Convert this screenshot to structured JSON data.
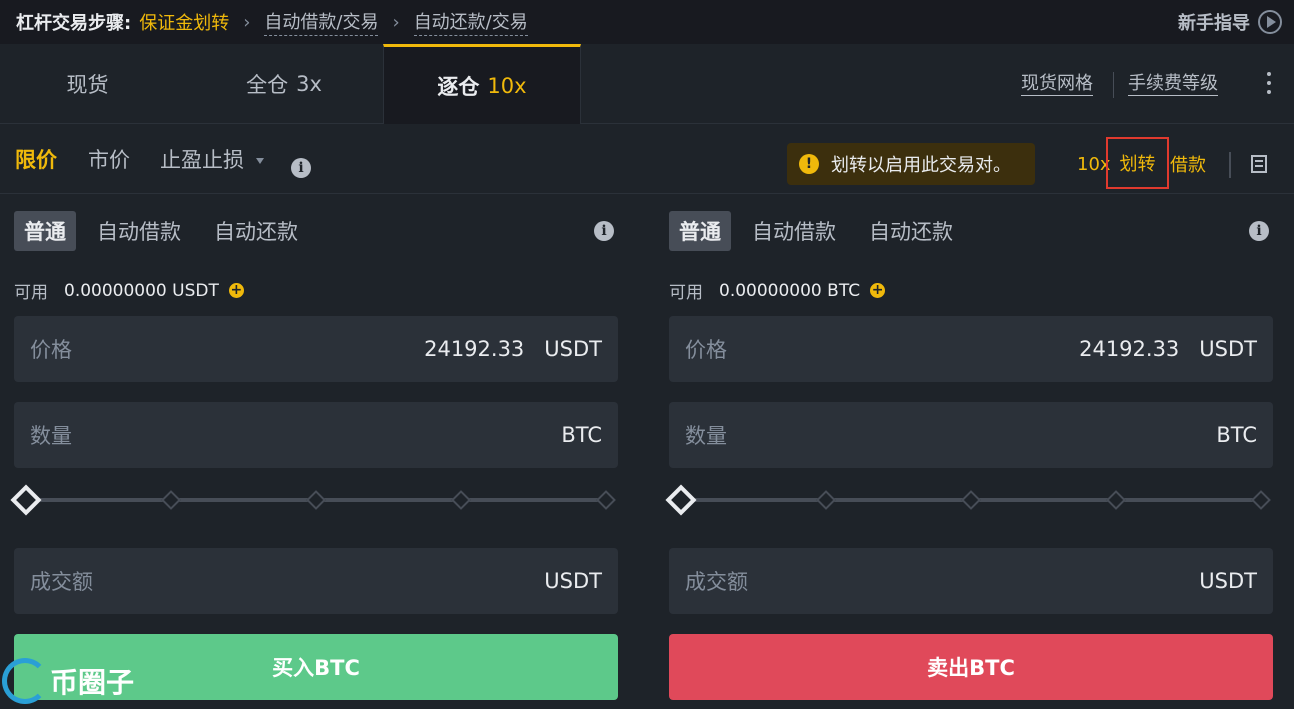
{
  "breadcrumb": {
    "title": "杠杆交易步骤:",
    "step1": "保证金划转",
    "step2": "自动借款/交易",
    "step3": "自动还款/交易",
    "guide": "新手指导"
  },
  "mode_tabs": [
    {
      "label": "现货",
      "leverage": ""
    },
    {
      "label": "全仓",
      "leverage": "3x"
    },
    {
      "label": "逐仓",
      "leverage": "10x"
    }
  ],
  "top_links": {
    "grid": "现货网格",
    "fee": "手续费等级"
  },
  "order_types": {
    "limit": "限价",
    "market": "市价",
    "stop": "止盈止损"
  },
  "banner": {
    "text": "划转以启用此交易对。"
  },
  "actions": {
    "leverage": "10x",
    "transfer": "划转",
    "borrow": "借款"
  },
  "buy_panel": {
    "subtabs": [
      "普通",
      "自动借款",
      "自动还款"
    ],
    "available_label": "可用",
    "available_value": "0.00000000 USDT",
    "price": {
      "label": "价格",
      "value": "24192.33",
      "unit": "USDT"
    },
    "amount": {
      "label": "数量",
      "value": "",
      "unit": "BTC"
    },
    "slider_value": 0,
    "total": {
      "label": "成交额",
      "unit": "USDT"
    },
    "button": "买入BTC"
  },
  "sell_panel": {
    "subtabs": [
      "普通",
      "自动借款",
      "自动还款"
    ],
    "available_label": "可用",
    "available_value": "0.00000000 BTC",
    "price": {
      "label": "价格",
      "value": "24192.33",
      "unit": "USDT"
    },
    "amount": {
      "label": "数量",
      "value": "",
      "unit": "BTC"
    },
    "slider_value": 0,
    "total": {
      "label": "成交额",
      "unit": "USDT"
    },
    "button": "卖出BTC"
  },
  "watermark": {
    "text": "币圈子"
  },
  "colors": {
    "accent": "#f0b90b",
    "buy": "#5dc98a",
    "sell": "#e0495a",
    "highlight_box": "#e03a2e"
  }
}
